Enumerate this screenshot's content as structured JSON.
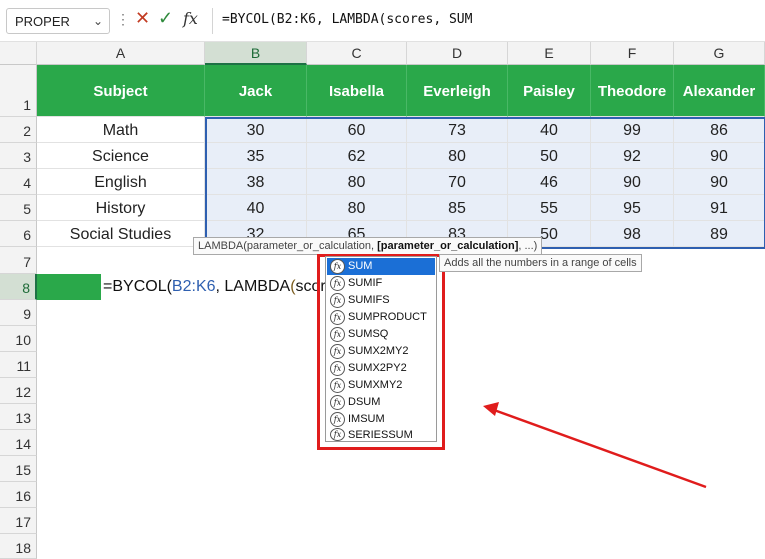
{
  "formula_bar": {
    "name_box": "PROPER",
    "formula": "=BYCOL(B2:K6, LAMBDA(scores, SUM",
    "fx_label": "fx"
  },
  "columns": [
    "A",
    "B",
    "C",
    "D",
    "E",
    "F",
    "G"
  ],
  "rows": [
    "1",
    "2",
    "3",
    "4",
    "5",
    "6",
    "7",
    "8",
    "9",
    "10",
    "11",
    "12",
    "13",
    "14",
    "15",
    "16",
    "17",
    "18"
  ],
  "table": {
    "header": [
      "Subject",
      "Jack",
      "Isabella",
      "Everleigh",
      "Paisley",
      "Theodore",
      "Alexander"
    ],
    "data": [
      [
        "Math",
        "30",
        "60",
        "73",
        "40",
        "99",
        "86"
      ],
      [
        "Science",
        "35",
        "62",
        "80",
        "50",
        "92",
        "90"
      ],
      [
        "English",
        "38",
        "80",
        "70",
        "46",
        "90",
        "90"
      ],
      [
        "History",
        "40",
        "80",
        "85",
        "55",
        "95",
        "91"
      ],
      [
        "Social Studies",
        "32",
        "65",
        "83",
        "50",
        "98",
        "89"
      ]
    ]
  },
  "edit_cell": {
    "part1": "=BYCOL(",
    "ref": "B2:K6",
    "part2": ", LAMBDA",
    "paren": "(",
    "part3": "scores, SUM"
  },
  "tooltip": {
    "prefix": "LAMBDA(parameter_or_calculation, ",
    "bold": "[parameter_or_calculation]",
    "suffix": ", ...)"
  },
  "autocomplete": {
    "items": [
      "SUM",
      "SUMIF",
      "SUMIFS",
      "SUMPRODUCT",
      "SUMSQ",
      "SUMX2MY2",
      "SUMX2PY2",
      "SUMXMY2",
      "DSUM",
      "IMSUM",
      "SERIESSUM"
    ],
    "selected": "SUM",
    "description": "Adds all the numbers in a range of cells"
  },
  "colors": {
    "header_green": "#2aa84a",
    "selection_blue": "#2e5fb0",
    "annotation_red": "#e01c1c"
  }
}
